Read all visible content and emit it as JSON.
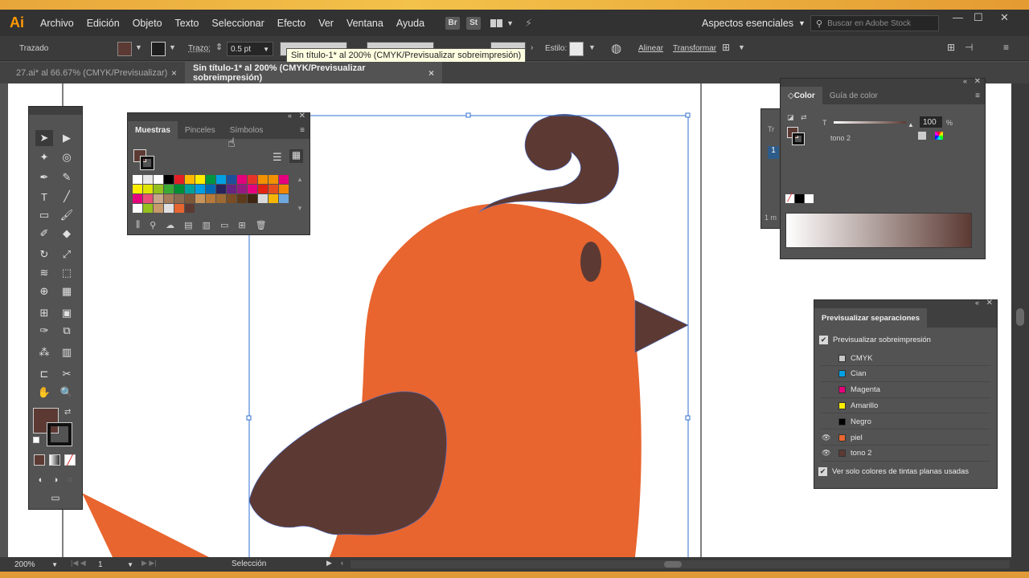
{
  "app": {
    "logo": "Ai"
  },
  "menu": [
    "Archivo",
    "Edición",
    "Objeto",
    "Texto",
    "Seleccionar",
    "Efecto",
    "Ver",
    "Ventana",
    "Ayuda"
  ],
  "menu_buttons": [
    "Br",
    "St"
  ],
  "workspace": "Aspectos esenciales",
  "stock_search_placeholder": "Buscar en Adobe Stock",
  "control_bar": {
    "object_label": "Trazado",
    "stroke_label": "Trazo:",
    "stroke_value": "0.5 pt",
    "style_label": "Estilo:",
    "align_label": "Alinear",
    "transform_label": "Transformar",
    "fill_color": "#5c3a33"
  },
  "tooltip": "Sin título-1* al 200% (CMYK/Previsualizar sobreimpresión)",
  "doc_tabs": [
    {
      "label": "27.ai* al 66.67% (CMYK/Previsualizar)",
      "close": "×"
    },
    {
      "label": "Sin título-1* al 200% (CMYK/Previsualizar sobreimpresión)",
      "close": "×"
    }
  ],
  "swatches_panel": {
    "tabs": [
      "Muestras",
      "Pinceles",
      "Símbolos"
    ],
    "rows": [
      [
        "#ffffff",
        "#e8e8e8",
        "#ffffff",
        "#000000",
        "#e31e24",
        "#fbb900",
        "#ffed00",
        "#009640",
        "#00a0e3",
        "#1d4f9c",
        "#e4007c",
        "#e6332a",
        "#f39200",
        "#f29100",
        "#e5007d"
      ],
      [
        "#ffed00",
        "#dfe300",
        "#95c11f",
        "#3aaa35",
        "#008d36",
        "#00a19a",
        "#009ee3",
        "#0069b4",
        "#29235c",
        "#662483",
        "#951b81",
        "#e6007e",
        "#e42313",
        "#e84e1b",
        "#f18700"
      ],
      [
        "#e5007d",
        "#e94e77",
        "#c7a68a",
        "#a57b5a",
        "#8b6a52",
        "#7c5639",
        "#c8955d",
        "#b7793a",
        "#9d6a33",
        "#7a4d24",
        "#5e3b1b",
        "#3e2612",
        "#d9d9d9",
        "#f5b500",
        "#6ea7dd"
      ],
      [
        "#ffffff",
        "#95c11f",
        "#c89a6b",
        "#e0e0e0",
        "#e8652f",
        "#5c3a33"
      ]
    ]
  },
  "color_panel": {
    "tabs": [
      "Color",
      "Guía de color"
    ],
    "tint_letter": "T",
    "tint_value": "100",
    "percent": "%",
    "swatch_name": "tono 2",
    "partial_label_1": "Tr",
    "partial_label_2": "1",
    "partial_label_3": "1 m"
  },
  "separations_panel": {
    "title": "Previsualizar separaciones",
    "overprint_label": "Previsualizar sobreimpresión",
    "plates": [
      {
        "name": "CMYK",
        "color": "#c8c8c8",
        "eye": ""
      },
      {
        "name": "Cian",
        "color": "#00a0e3",
        "eye": ""
      },
      {
        "name": "Magenta",
        "color": "#e4007c",
        "eye": ""
      },
      {
        "name": "Amarillo",
        "color": "#ffed00",
        "eye": ""
      },
      {
        "name": "Negro",
        "color": "#000000",
        "eye": ""
      },
      {
        "name": "piel",
        "color": "#e8652f",
        "eye": "👁"
      },
      {
        "name": "tono 2",
        "color": "#5c3a33",
        "eye": "👁"
      }
    ],
    "spot_only_label": "Ver solo colores de tintas planas usadas"
  },
  "status": {
    "zoom": "200%",
    "page": "1",
    "tool_name": "Selección"
  },
  "colors": {
    "bird_body": "#e8652f",
    "bird_brown": "#5c3a33",
    "selection": "#2f6fd1"
  }
}
